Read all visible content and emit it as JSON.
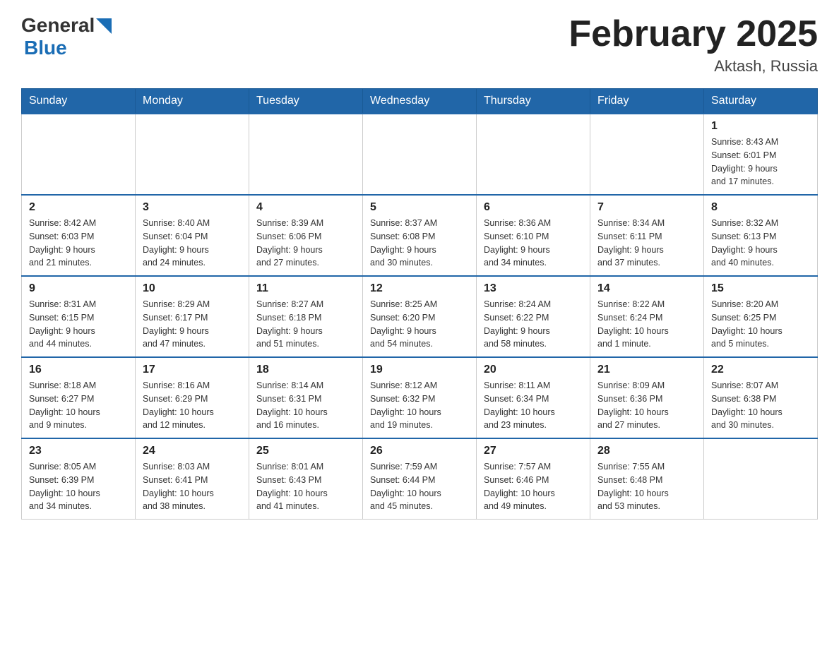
{
  "header": {
    "logo_general": "General",
    "logo_blue": "Blue",
    "month_title": "February 2025",
    "location": "Aktash, Russia"
  },
  "weekdays": [
    "Sunday",
    "Monday",
    "Tuesday",
    "Wednesday",
    "Thursday",
    "Friday",
    "Saturday"
  ],
  "weeks": [
    [
      {
        "day": "",
        "info": ""
      },
      {
        "day": "",
        "info": ""
      },
      {
        "day": "",
        "info": ""
      },
      {
        "day": "",
        "info": ""
      },
      {
        "day": "",
        "info": ""
      },
      {
        "day": "",
        "info": ""
      },
      {
        "day": "1",
        "info": "Sunrise: 8:43 AM\nSunset: 6:01 PM\nDaylight: 9 hours\nand 17 minutes."
      }
    ],
    [
      {
        "day": "2",
        "info": "Sunrise: 8:42 AM\nSunset: 6:03 PM\nDaylight: 9 hours\nand 21 minutes."
      },
      {
        "day": "3",
        "info": "Sunrise: 8:40 AM\nSunset: 6:04 PM\nDaylight: 9 hours\nand 24 minutes."
      },
      {
        "day": "4",
        "info": "Sunrise: 8:39 AM\nSunset: 6:06 PM\nDaylight: 9 hours\nand 27 minutes."
      },
      {
        "day": "5",
        "info": "Sunrise: 8:37 AM\nSunset: 6:08 PM\nDaylight: 9 hours\nand 30 minutes."
      },
      {
        "day": "6",
        "info": "Sunrise: 8:36 AM\nSunset: 6:10 PM\nDaylight: 9 hours\nand 34 minutes."
      },
      {
        "day": "7",
        "info": "Sunrise: 8:34 AM\nSunset: 6:11 PM\nDaylight: 9 hours\nand 37 minutes."
      },
      {
        "day": "8",
        "info": "Sunrise: 8:32 AM\nSunset: 6:13 PM\nDaylight: 9 hours\nand 40 minutes."
      }
    ],
    [
      {
        "day": "9",
        "info": "Sunrise: 8:31 AM\nSunset: 6:15 PM\nDaylight: 9 hours\nand 44 minutes."
      },
      {
        "day": "10",
        "info": "Sunrise: 8:29 AM\nSunset: 6:17 PM\nDaylight: 9 hours\nand 47 minutes."
      },
      {
        "day": "11",
        "info": "Sunrise: 8:27 AM\nSunset: 6:18 PM\nDaylight: 9 hours\nand 51 minutes."
      },
      {
        "day": "12",
        "info": "Sunrise: 8:25 AM\nSunset: 6:20 PM\nDaylight: 9 hours\nand 54 minutes."
      },
      {
        "day": "13",
        "info": "Sunrise: 8:24 AM\nSunset: 6:22 PM\nDaylight: 9 hours\nand 58 minutes."
      },
      {
        "day": "14",
        "info": "Sunrise: 8:22 AM\nSunset: 6:24 PM\nDaylight: 10 hours\nand 1 minute."
      },
      {
        "day": "15",
        "info": "Sunrise: 8:20 AM\nSunset: 6:25 PM\nDaylight: 10 hours\nand 5 minutes."
      }
    ],
    [
      {
        "day": "16",
        "info": "Sunrise: 8:18 AM\nSunset: 6:27 PM\nDaylight: 10 hours\nand 9 minutes."
      },
      {
        "day": "17",
        "info": "Sunrise: 8:16 AM\nSunset: 6:29 PM\nDaylight: 10 hours\nand 12 minutes."
      },
      {
        "day": "18",
        "info": "Sunrise: 8:14 AM\nSunset: 6:31 PM\nDaylight: 10 hours\nand 16 minutes."
      },
      {
        "day": "19",
        "info": "Sunrise: 8:12 AM\nSunset: 6:32 PM\nDaylight: 10 hours\nand 19 minutes."
      },
      {
        "day": "20",
        "info": "Sunrise: 8:11 AM\nSunset: 6:34 PM\nDaylight: 10 hours\nand 23 minutes."
      },
      {
        "day": "21",
        "info": "Sunrise: 8:09 AM\nSunset: 6:36 PM\nDaylight: 10 hours\nand 27 minutes."
      },
      {
        "day": "22",
        "info": "Sunrise: 8:07 AM\nSunset: 6:38 PM\nDaylight: 10 hours\nand 30 minutes."
      }
    ],
    [
      {
        "day": "23",
        "info": "Sunrise: 8:05 AM\nSunset: 6:39 PM\nDaylight: 10 hours\nand 34 minutes."
      },
      {
        "day": "24",
        "info": "Sunrise: 8:03 AM\nSunset: 6:41 PM\nDaylight: 10 hours\nand 38 minutes."
      },
      {
        "day": "25",
        "info": "Sunrise: 8:01 AM\nSunset: 6:43 PM\nDaylight: 10 hours\nand 41 minutes."
      },
      {
        "day": "26",
        "info": "Sunrise: 7:59 AM\nSunset: 6:44 PM\nDaylight: 10 hours\nand 45 minutes."
      },
      {
        "day": "27",
        "info": "Sunrise: 7:57 AM\nSunset: 6:46 PM\nDaylight: 10 hours\nand 49 minutes."
      },
      {
        "day": "28",
        "info": "Sunrise: 7:55 AM\nSunset: 6:48 PM\nDaylight: 10 hours\nand 53 minutes."
      },
      {
        "day": "",
        "info": ""
      }
    ]
  ]
}
